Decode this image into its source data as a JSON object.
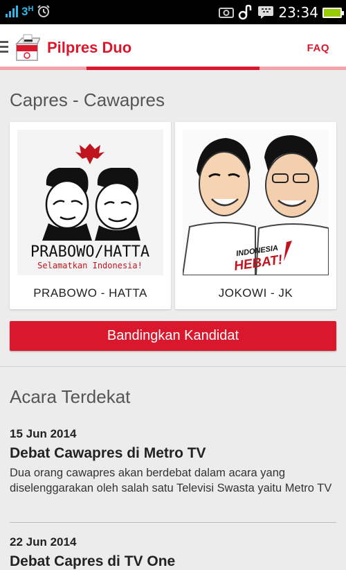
{
  "statusbar": {
    "network": "3",
    "network_sub": "H",
    "time": "23:34"
  },
  "appbar": {
    "title": "Pilpres Duo",
    "faq": "FAQ"
  },
  "colors": {
    "accent": "#d9182d",
    "tab_active": "#d9182d",
    "tab_inactive": "#f3a3ab"
  },
  "candidates_section": {
    "title": "Capres - Cawapres",
    "cards": [
      {
        "label": "PRABOWO - HATTA",
        "poster_title": "PRABOWO/HATTA",
        "poster_subtitle": "Selamatkan Indonesia!"
      },
      {
        "label": "JOKOWI - JK",
        "poster_line1": "INDONESIA",
        "poster_line2": "HEBAT!"
      }
    ],
    "compare_button": "Bandingkan Kandidat"
  },
  "events_section": {
    "title": "Acara Terdekat",
    "events": [
      {
        "date": "15 Jun 2014",
        "title": "Debat Cawapres di Metro TV",
        "description": "Dua orang cawapres akan berdebat dalam acara yang diselenggarakan oleh salah satu Televisi Swasta yaitu Metro TV"
      },
      {
        "date": "22 Jun 2014",
        "title": "Debat Capres di TV One",
        "description": ""
      }
    ]
  }
}
